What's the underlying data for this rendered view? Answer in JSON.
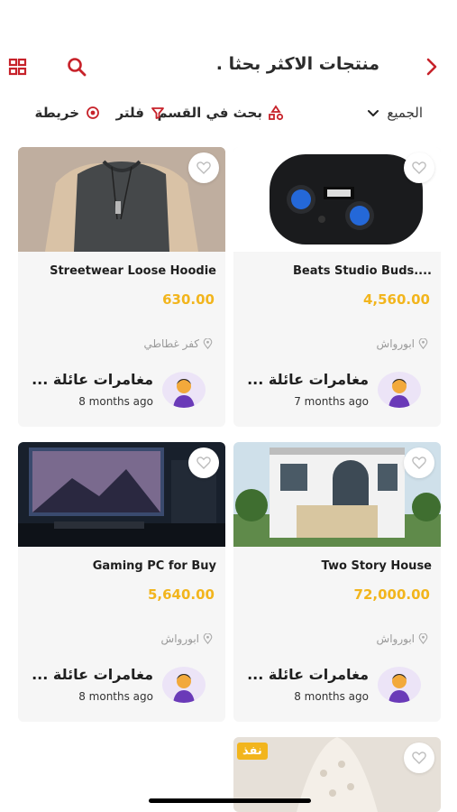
{
  "header": {
    "title": "منتجات الاكثر بحثا .",
    "back_icon": "chevron-right-icon",
    "search_icon": "search-icon",
    "grid_icon": "grid-view-icon"
  },
  "filters": {
    "all_label": "الجميع",
    "search_in_section_label": "بحث في القسم",
    "filter_label": "فلتر",
    "map_label": "خريطة"
  },
  "colors": {
    "accent": "#c7222a",
    "price": "#f2b51d",
    "card_bg": "#f6f6f6"
  },
  "products": [
    {
      "title": "Streetwear Loose Hoodie",
      "price": "630.00",
      "location": "كفر غطاطي",
      "seller": "مغامرات عائلة ...",
      "time": "8 months ago",
      "image": "hoodie"
    },
    {
      "title": "Beats Studio Buds....",
      "price": "4,560.00",
      "location": "ابورواش",
      "seller": "مغامرات عائلة ...",
      "time": "7 months ago",
      "image": "earbuds"
    },
    {
      "title": "Gaming PC for Buy",
      "price": "5,640.00",
      "location": "ابورواش",
      "seller": "مغامرات عائلة ...",
      "time": "8 months ago",
      "image": "gaming-pc"
    },
    {
      "title": "Two Story House",
      "price": "72,000.00",
      "location": "ابورواش",
      "seller": "مغامرات عائلة ...",
      "time": "8 months ago",
      "image": "house"
    }
  ],
  "partial_card": {
    "badge": "نفذ",
    "image": "wedding-dress"
  }
}
